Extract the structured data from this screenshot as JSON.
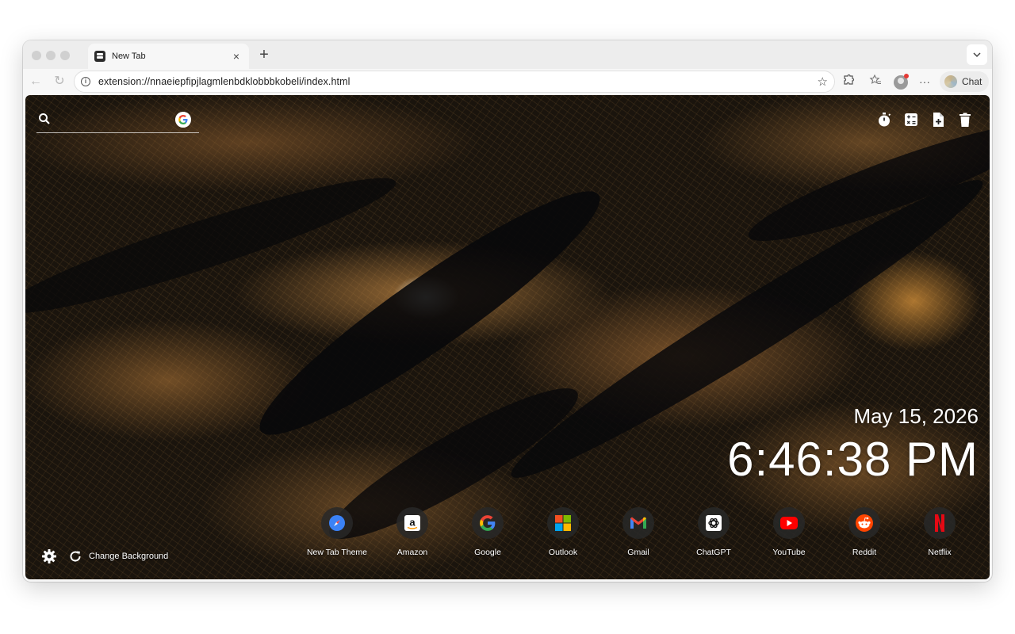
{
  "tab": {
    "title": "New Tab",
    "close_glyph": "×"
  },
  "toolbar": {
    "new_tab_glyph": "+",
    "tab_dropdown_glyph": "⌄",
    "back_glyph": "←",
    "reload_glyph": "↻",
    "url": "extension://nnaeiepfipjlagmlenbdklobbbkobeli/index.html",
    "info_glyph": "i",
    "bookmark_glyph": "☆",
    "more_glyph": "···",
    "chat_label": "Chat"
  },
  "newtab": {
    "search": {
      "placeholder": ""
    },
    "date": "May 15, 2026",
    "time": "6:46:38 PM",
    "change_background_label": "Change Background",
    "shortcuts": [
      {
        "label": "New Tab Theme",
        "icon": "compass-icon"
      },
      {
        "label": "Amazon",
        "icon": "amazon-icon"
      },
      {
        "label": "Google",
        "icon": "google-icon"
      },
      {
        "label": "Outlook",
        "icon": "microsoft-icon"
      },
      {
        "label": "Gmail",
        "icon": "gmail-icon"
      },
      {
        "label": "ChatGPT",
        "icon": "chatgpt-icon"
      },
      {
        "label": "YouTube",
        "icon": "youtube-icon"
      },
      {
        "label": "Reddit",
        "icon": "reddit-icon"
      },
      {
        "label": "Netflix",
        "icon": "netflix-icon"
      }
    ]
  },
  "colors": {
    "google_blue": "#4285F4",
    "google_red": "#EA4335",
    "google_yellow": "#FBBC05",
    "google_green": "#34A853",
    "youtube_red": "#FF0000",
    "reddit_orange": "#FF4500",
    "netflix_red": "#E50914"
  }
}
